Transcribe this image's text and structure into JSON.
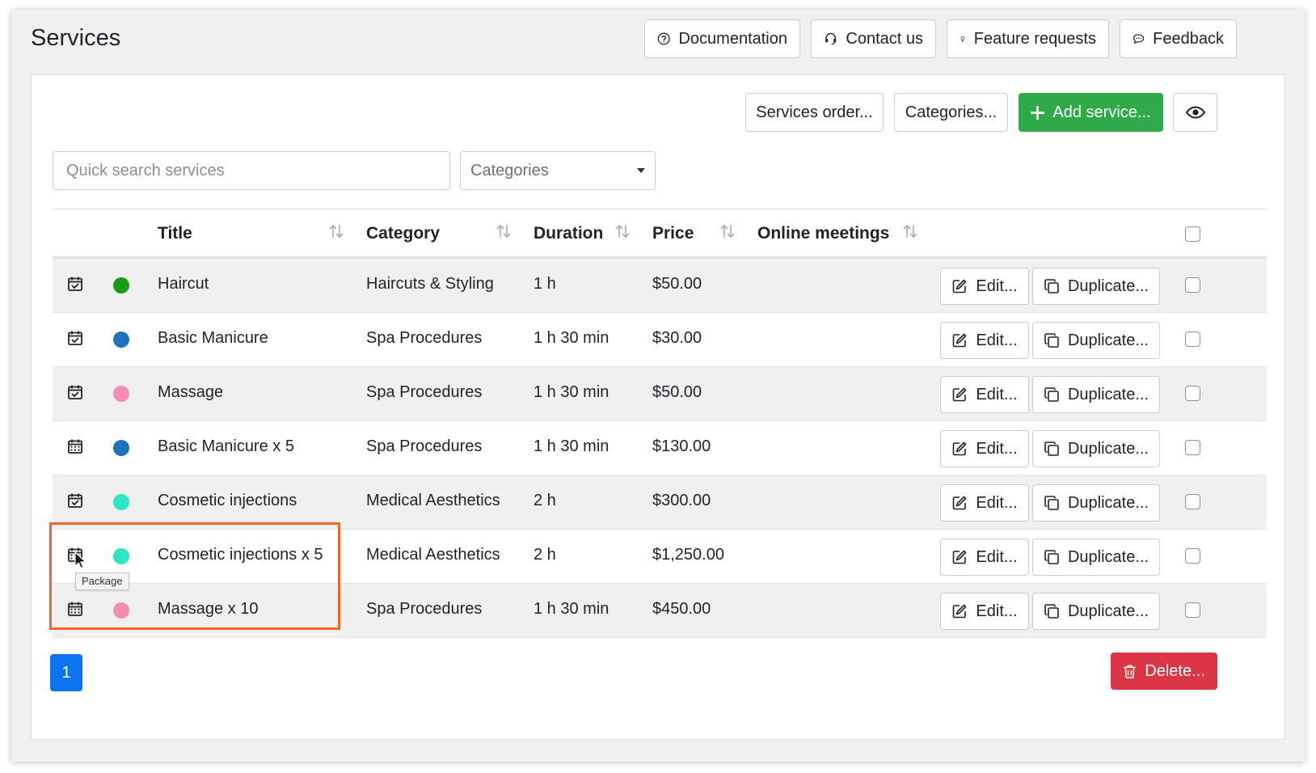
{
  "header": {
    "title": "Services",
    "buttons": [
      {
        "label": "Documentation",
        "icon": "question-circle-icon"
      },
      {
        "label": "Contact us",
        "icon": "headset-icon"
      },
      {
        "label": "Feature requests",
        "icon": "lightbulb-icon"
      },
      {
        "label": "Feedback",
        "icon": "chat-icon"
      }
    ]
  },
  "toolbar": {
    "services_order_label": "Services order...",
    "categories_label": "Categories...",
    "add_service_label": "Add service...",
    "visibility_icon": "eye-icon"
  },
  "filters": {
    "search_placeholder": "Quick search services",
    "category_select": "Categories"
  },
  "table": {
    "columns": {
      "title": "Title",
      "category": "Category",
      "duration": "Duration",
      "price": "Price",
      "online_meetings": "Online meetings"
    },
    "edit_label": "Edit...",
    "duplicate_label": "Duplicate...",
    "rows": [
      {
        "icon": "calendar-check-icon",
        "color": "#1a9c1a",
        "title": "Haircut",
        "category": "Haircuts & Styling",
        "duration": "1 h",
        "price": "$50.00"
      },
      {
        "icon": "calendar-check-icon",
        "color": "#1e73be",
        "title": "Basic Manicure",
        "category": "Spa Procedures",
        "duration": "1 h 30 min",
        "price": "$30.00"
      },
      {
        "icon": "calendar-check-icon",
        "color": "#f78bb3",
        "title": "Massage",
        "category": "Spa Procedures",
        "duration": "1 h 30 min",
        "price": "$50.00"
      },
      {
        "icon": "calendar-package-icon",
        "color": "#1e73be",
        "title": "Basic Manicure x 5",
        "category": "Spa Procedures",
        "duration": "1 h 30 min",
        "price": "$130.00"
      },
      {
        "icon": "calendar-check-icon",
        "color": "#2ee6c1",
        "title": "Cosmetic injections",
        "category": "Medical Aesthetics",
        "duration": "2 h",
        "price": "$300.00"
      },
      {
        "icon": "calendar-package-icon",
        "color": "#2ee6c1",
        "title": "Cosmetic injections x 5",
        "category": "Medical Aesthetics",
        "duration": "2 h",
        "price": "$1,250.00"
      },
      {
        "icon": "calendar-package-icon",
        "color": "#f78bb3",
        "title": "Massage x 10",
        "category": "Spa Procedures",
        "duration": "1 h 30 min",
        "price": "$450.00"
      }
    ]
  },
  "tooltip": "Package",
  "pagination": {
    "current_page": "1"
  },
  "delete_label": "Delete..."
}
